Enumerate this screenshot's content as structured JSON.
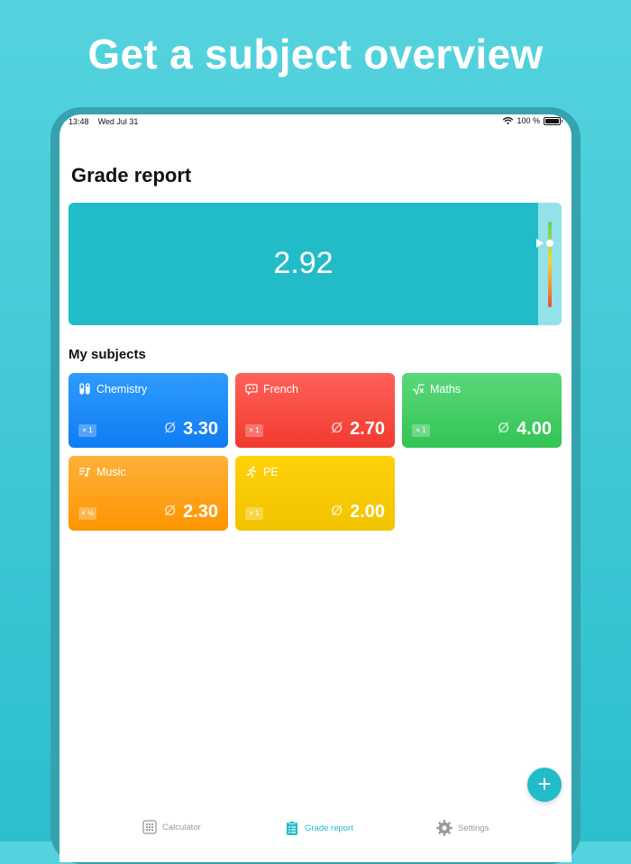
{
  "headline": "Get a subject overview",
  "status_bar": {
    "time": "13:48",
    "date": "Wed Jul 31",
    "battery": "100 %"
  },
  "page_title": "Grade report",
  "overall": {
    "average": "2.92",
    "scale_position": 0.25
  },
  "section_title": "My subjects",
  "subjects": [
    {
      "name": "Chemistry",
      "icon": "test-tubes-icon",
      "weight": "× 1",
      "avg_symbol": "Ø",
      "average": "3.30",
      "color": "#1a86f8"
    },
    {
      "name": "French",
      "icon": "speech-bubble-icon",
      "weight": "× 1",
      "avg_symbol": "Ø",
      "average": "2.70",
      "color": "#f94a41"
    },
    {
      "name": "Maths",
      "icon": "square-root-icon",
      "weight": "× 1",
      "avg_symbol": "Ø",
      "average": "4.00",
      "color": "#43cc63"
    },
    {
      "name": "Music",
      "icon": "music-list-icon",
      "weight": "× ½",
      "avg_symbol": "Ø",
      "average": "2.30",
      "color": "#fea21c"
    },
    {
      "name": "PE",
      "icon": "running-figure-icon",
      "weight": "× 1",
      "avg_symbol": "Ø",
      "average": "2.00",
      "color": "#f9cb05"
    }
  ],
  "fab": {
    "icon": "plus-icon",
    "label": "+"
  },
  "tabs": [
    {
      "label": "Calculator",
      "icon": "calculator-icon",
      "active": false
    },
    {
      "label": "Grade report",
      "icon": "clipboard-icon",
      "active": true
    },
    {
      "label": "Settings",
      "icon": "gear-icon",
      "active": false
    }
  ],
  "colors": {
    "accent": "#22bcc9",
    "background": "#43c9d6"
  }
}
